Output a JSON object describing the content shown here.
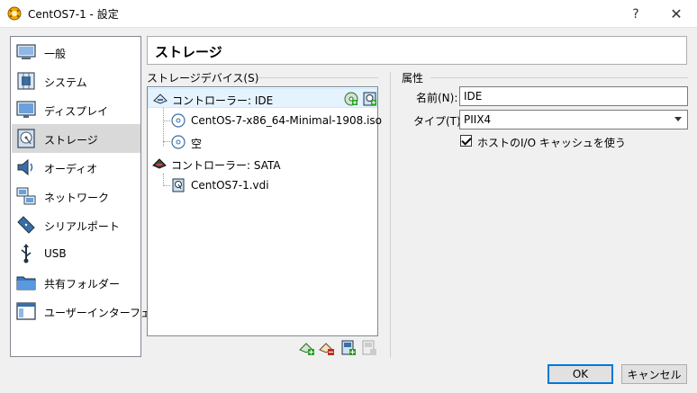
{
  "window": {
    "title": "CentOS7-1 - 設定",
    "help_label": "?",
    "close_label": "✕"
  },
  "sidebar": {
    "items": [
      {
        "label": "一般",
        "icon": "general-icon"
      },
      {
        "label": "システム",
        "icon": "system-icon"
      },
      {
        "label": "ディスプレイ",
        "icon": "display-icon"
      },
      {
        "label": "ストレージ",
        "icon": "storage-icon"
      },
      {
        "label": "オーディオ",
        "icon": "audio-icon"
      },
      {
        "label": "ネットワーク",
        "icon": "network-icon"
      },
      {
        "label": "シリアルポート",
        "icon": "serial-port-icon"
      },
      {
        "label": "USB",
        "icon": "usb-icon"
      },
      {
        "label": "共有フォルダー",
        "icon": "shared-folder-icon"
      },
      {
        "label": "ユーザーインターフェース",
        "icon": "user-interface-icon"
      }
    ],
    "active_index": 3
  },
  "page": {
    "title": "ストレージ"
  },
  "storage": {
    "group_label": "ストレージデバイス(S)",
    "tree": [
      {
        "label": "コントローラー: IDE",
        "type": "controller",
        "icon": "ide-controller-icon"
      },
      {
        "label": "CentOS-7-x86_64-Minimal-1908.iso",
        "type": "optical",
        "icon": "optical-disk-icon"
      },
      {
        "label": "空",
        "type": "optical",
        "icon": "optical-disk-icon"
      },
      {
        "label": "コントローラー: SATA",
        "type": "controller",
        "icon": "sata-controller-icon"
      },
      {
        "label": "CentOS7-1.vdi",
        "type": "harddisk",
        "icon": "hard-disk-icon"
      }
    ],
    "selected_index": 0
  },
  "attributes": {
    "group_label": "属性",
    "name_label": "名前(N):",
    "name_value": "IDE",
    "type_label": "タイプ(T):",
    "type_value": "PIIX4",
    "cache_label": "ホストのI/O キャッシュを使う",
    "cache_checked": true
  },
  "buttons": {
    "ok": "OK",
    "cancel": "キャンセル"
  },
  "colors": {
    "accent": "#0078d7",
    "selected_bg": "#e5f3ff",
    "active_sidebar": "#d9d9d9"
  }
}
